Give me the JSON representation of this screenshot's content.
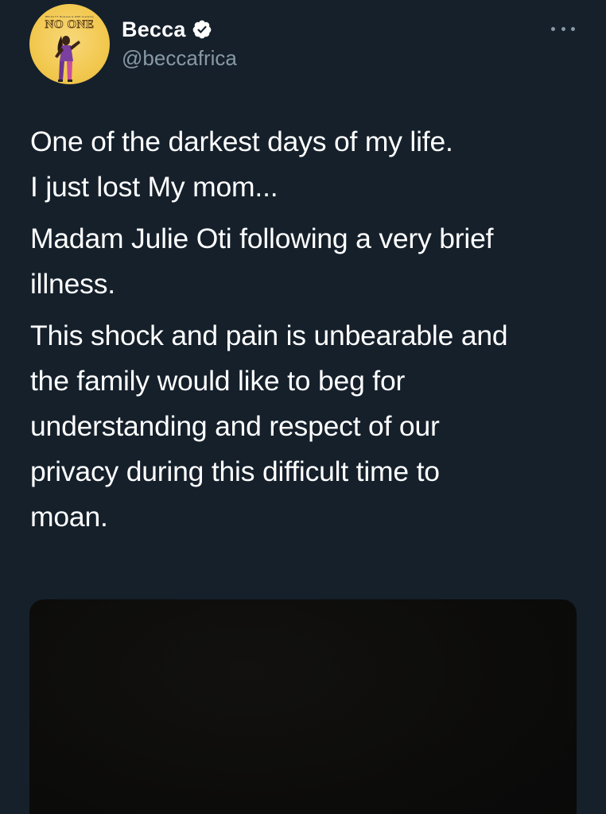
{
  "author": {
    "display_name": "Becca",
    "handle": "@beccafrica",
    "verified": true,
    "avatar": {
      "cover_caption": "BECCA FT. Busiswa & DWP Academy",
      "cover_title": "NO ONE"
    }
  },
  "tweet": {
    "paragraphs": [
      "One of the darkest days of my life.\nI just lost My mom...",
      "Madam Julie Oti following a very brief\nillness.",
      "This shock and pain is unbearable and\nthe family would like to beg for\nunderstanding and respect of our\nprivacy during this difficult time to\nmoan."
    ]
  },
  "icons": {
    "verified": "verified-badge-icon",
    "more": "more-options-icon"
  },
  "colors": {
    "background": "#15202b",
    "text_primary": "#ffffff",
    "text_secondary": "#8899a6"
  }
}
